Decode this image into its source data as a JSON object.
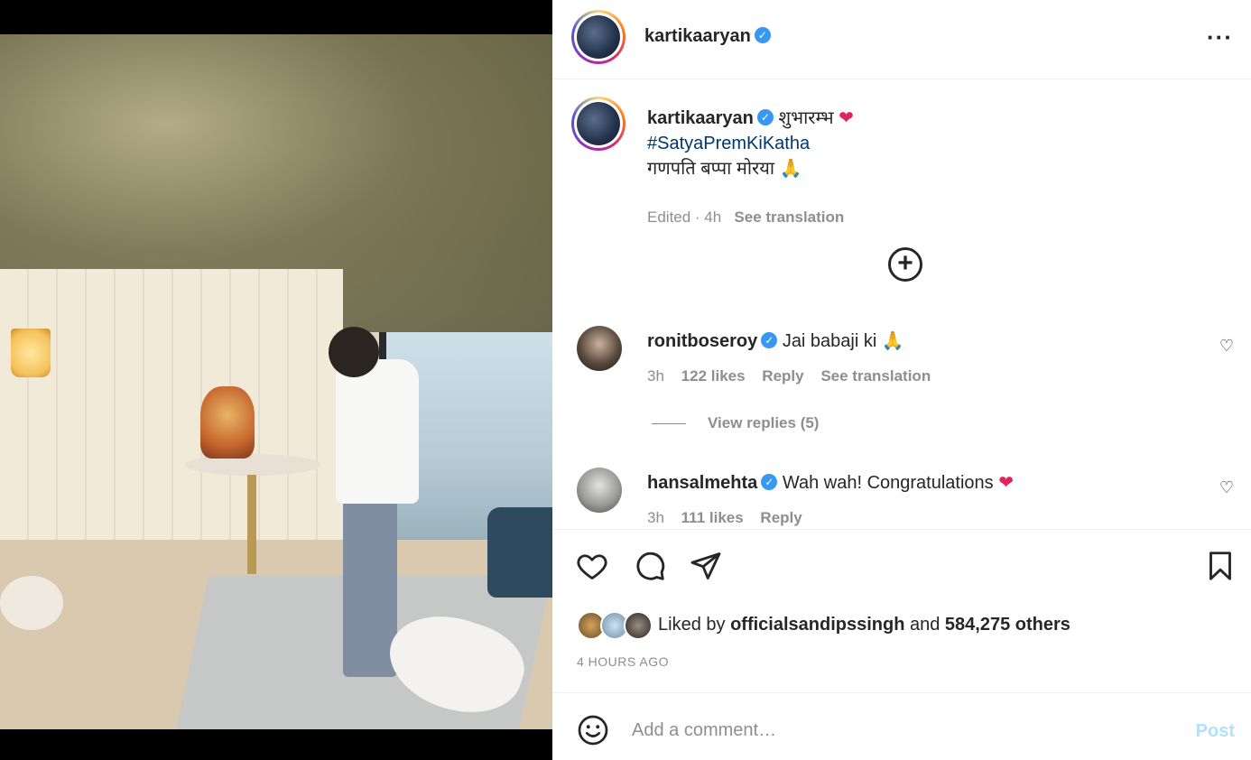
{
  "post": {
    "author": "kartikaaryan",
    "more_icon": "more-horizontal-icon",
    "caption": {
      "user": "kartikaaryan",
      "line1": "शुभारम्भ",
      "hashtag": "#SatyaPremKiKatha",
      "line3": "गणपति बप्पा मोरया",
      "edited": "Edited · 4h",
      "see_translation": "See translation"
    }
  },
  "comments": [
    {
      "user": "ronitboseroy",
      "text": "Jai babaji ki",
      "time": "3h",
      "likes": "122 likes",
      "reply": "Reply",
      "see_translation": "See translation",
      "view_replies": "View replies (5)"
    },
    {
      "user": "hansalmehta",
      "text": "Wah wah! Congratulations",
      "time": "3h",
      "likes": "111 likes",
      "reply": "Reply"
    }
  ],
  "likes": {
    "prefix": "Liked by",
    "user": "officialsandipssingh",
    "middle": "and",
    "count": "584,275 others"
  },
  "timestamp": "4 HOURS AGO",
  "add_comment": {
    "placeholder": "Add a comment…",
    "post_label": "Post"
  },
  "colors": {
    "link": "#00376b",
    "verified": "#3897f0",
    "post_disabled": "#b2dffc",
    "heart": "#e0245e"
  }
}
